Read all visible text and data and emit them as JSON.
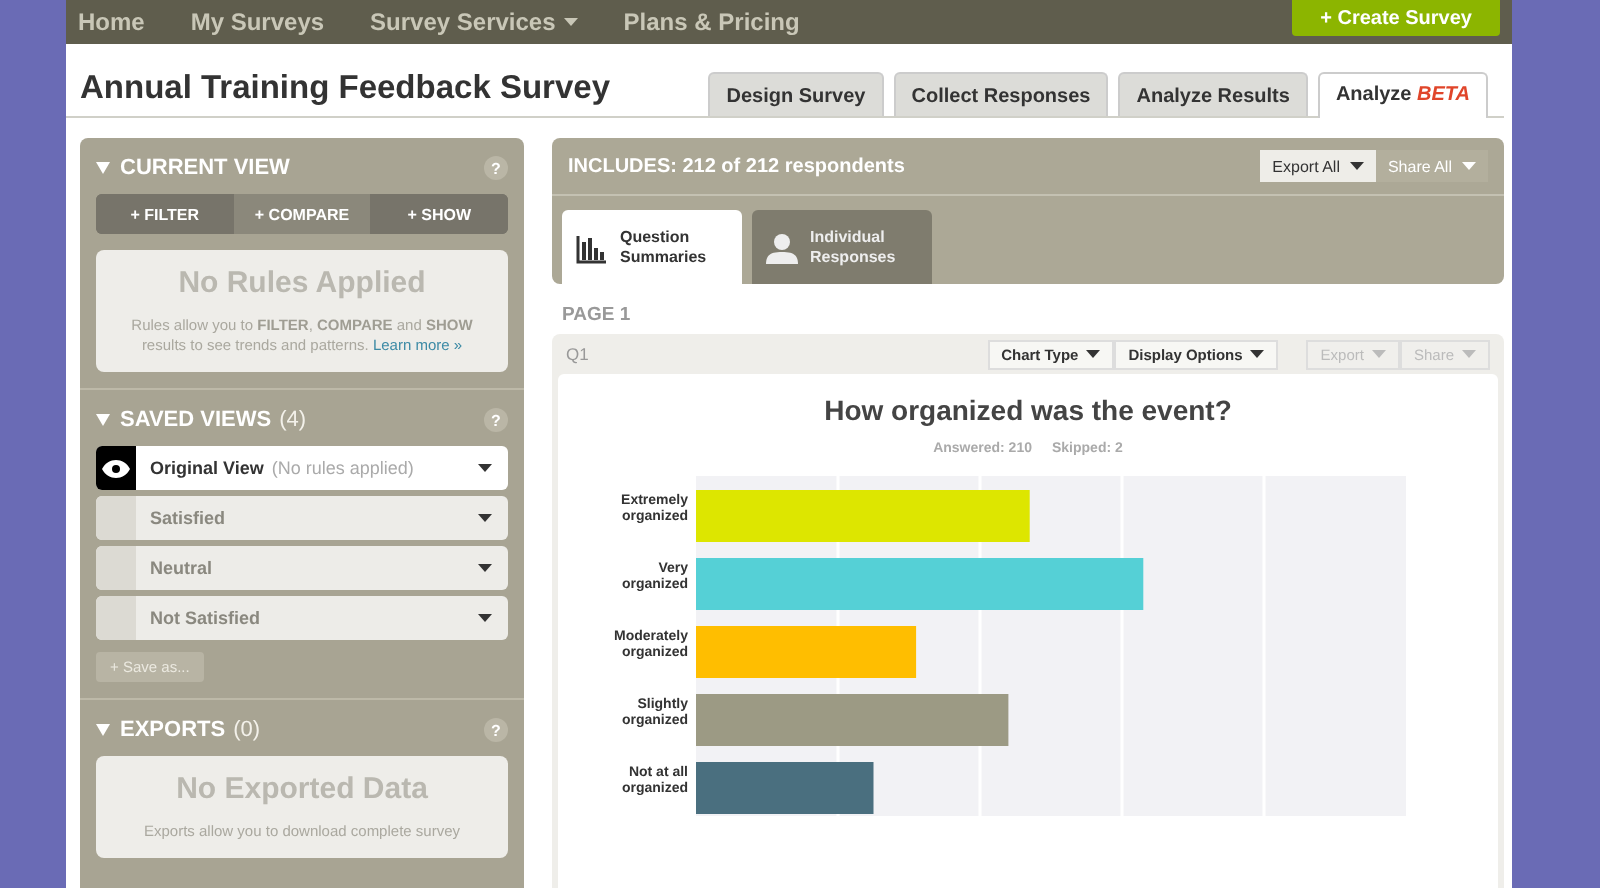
{
  "nav": {
    "items": [
      {
        "label": "Home",
        "dropdown": false
      },
      {
        "label": "My Surveys",
        "dropdown": false
      },
      {
        "label": "Survey Services",
        "dropdown": true
      },
      {
        "label": "Plans & Pricing",
        "dropdown": false
      }
    ],
    "create_button": "+ Create Survey"
  },
  "title": "Annual Training Feedback Survey",
  "tabs": [
    {
      "label": "Design Survey",
      "selected": false
    },
    {
      "label": "Collect Responses",
      "selected": false
    },
    {
      "label": "Analyze Results",
      "selected": false
    },
    {
      "label": "Analyze",
      "badge": "BETA",
      "selected": true
    }
  ],
  "sidebar": {
    "current_view": {
      "title": "CURRENT VIEW",
      "help": "?",
      "buttons": [
        "+ FILTER",
        "+ COMPARE",
        "+ SHOW"
      ],
      "empty_title": "No Rules Applied",
      "empty_text": "Rules allow you to **FILTER**, **COMPARE** and **SHOW** results to see trends and patterns.",
      "link": "Learn more »"
    },
    "saved_views": {
      "title": "SAVED VIEWS",
      "count": "(4)",
      "help": "?",
      "items": [
        {
          "label": "Original View",
          "note": "(No rules applied)",
          "selected": true
        },
        {
          "label": "Satisfied",
          "selected": false
        },
        {
          "label": "Neutral",
          "selected": false
        },
        {
          "label": "Not Satisfied",
          "selected": false
        }
      ],
      "save_button": "+ Save as..."
    },
    "exports": {
      "title": "EXPORTS",
      "count": "(0)",
      "help": "?",
      "empty_title": "No Exported Data",
      "empty_text": "Exports allow you to download complete survey"
    }
  },
  "main": {
    "includes": "INCLUDES: 212 of 212 respondents",
    "actions": [
      {
        "label": "Export All",
        "disabled": false
      },
      {
        "label": "Share All",
        "disabled": true
      }
    ],
    "view_tabs": [
      {
        "kind": "chart",
        "label": "Question Summaries",
        "selected": true
      },
      {
        "kind": "person",
        "label": "Individual Responses",
        "selected": false
      }
    ],
    "page_label": "PAGE 1",
    "question": {
      "number": "Q1",
      "tools": [
        {
          "label": "Chart Type",
          "disabled": false
        },
        {
          "label": "Display Options",
          "disabled": false
        },
        {
          "label": "Export",
          "disabled": true
        },
        {
          "label": "Share",
          "disabled": true
        }
      ],
      "title": "How organized was the event?",
      "answered": "Answered: 210",
      "skipped": "Skipped: 2",
      "chart": {
        "categories": [
          {
            "label": "Extremely organized",
            "color": "#dde600"
          },
          {
            "label": "Very organized",
            "color": "#55d0d6"
          },
          {
            "label": "Moderately organized",
            "color": "#ffbe00"
          },
          {
            "label": "Slightly organized",
            "color": "#9c9a84"
          },
          {
            "label": "Not at all organized",
            "color": "#4a6f7f"
          }
        ]
      }
    }
  }
}
